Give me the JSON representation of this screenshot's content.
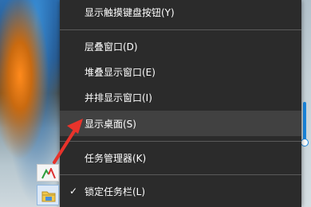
{
  "context_menu": {
    "items": [
      {
        "label": "显示触摸键盘按钮(Y)",
        "checked": false
      },
      {
        "label": "层叠窗口(D)",
        "checked": false
      },
      {
        "label": "堆叠显示窗口(E)",
        "checked": false
      },
      {
        "label": "并排显示窗口(I)",
        "checked": false
      },
      {
        "label": "显示桌面(S)",
        "checked": false,
        "highlighted": true
      },
      {
        "label": "任务管理器(K)",
        "checked": false
      },
      {
        "label": "锁定任务栏(L)",
        "checked": true,
        "check_mark": "✓"
      }
    ]
  },
  "colors": {
    "menu_background": "#2b2b2b",
    "menu_highlight": "#414141",
    "separator": "#5a5a5a",
    "annotation_arrow": "#e8332b"
  },
  "icons": [
    "taskbar-app-icon",
    "file-explorer-icon",
    "annotation-arrow-icon"
  ]
}
